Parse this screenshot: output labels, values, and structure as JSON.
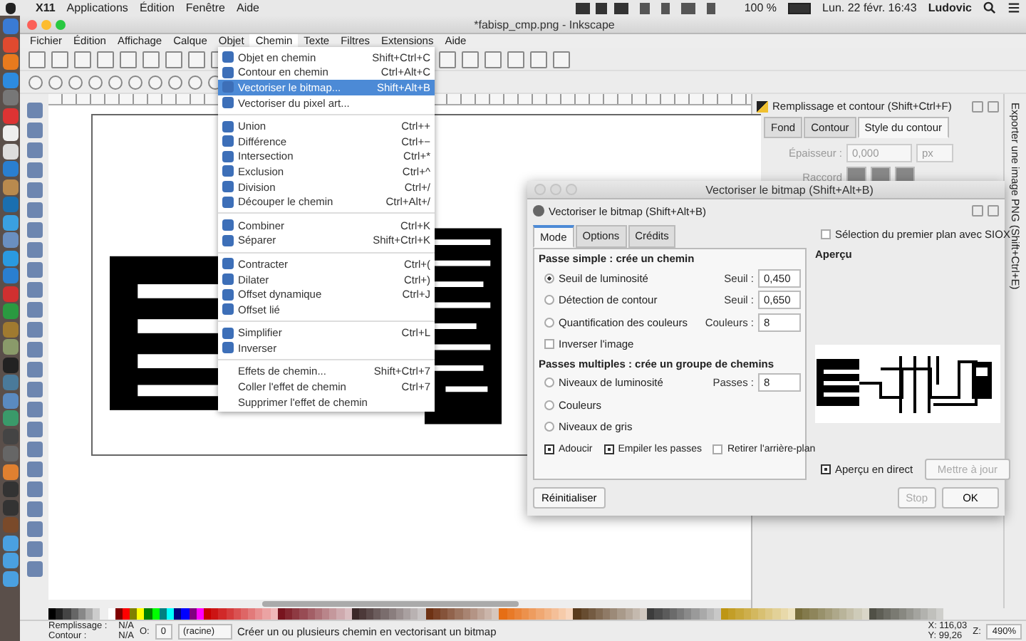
{
  "mac_menubar": {
    "app": "X11",
    "items": [
      "Applications",
      "Édition",
      "Fenêtre",
      "Aide"
    ],
    "battery": "100 %",
    "clock": "Lun. 22 févr. 16:43",
    "user": "Ludovic"
  },
  "window": {
    "title": "*fabisp_cmp.png - Inkscape"
  },
  "menubar": [
    {
      "label": "Fichier",
      "selected": false
    },
    {
      "label": "Édition",
      "selected": false
    },
    {
      "label": "Affichage",
      "selected": false
    },
    {
      "label": "Calque",
      "selected": false
    },
    {
      "label": "Objet",
      "selected": false
    },
    {
      "label": "Chemin",
      "selected": true
    },
    {
      "label": "Texte",
      "selected": false
    },
    {
      "label": "Filtres",
      "selected": false
    },
    {
      "label": "Extensions",
      "selected": false
    },
    {
      "label": "Aide",
      "selected": false
    }
  ],
  "chemin_menu": {
    "sections": [
      {
        "items": [
          {
            "label": "Objet en chemin",
            "shortcut": "Shift+Ctrl+C",
            "kind": "icon",
            "highlighted": false
          },
          {
            "label": "Contour en chemin",
            "shortcut": "Ctrl+Alt+C",
            "kind": "icon",
            "highlighted": false
          },
          {
            "label": "Vectoriser le bitmap...",
            "shortcut": "Shift+Alt+B",
            "kind": "icon",
            "highlighted": true
          },
          {
            "label": "Vectoriser du pixel art...",
            "kind": "icon",
            "highlighted": false
          }
        ]
      },
      {
        "items": [
          {
            "label": "Union",
            "shortcut": "Ctrl++",
            "kind": "icon",
            "highlighted": false
          },
          {
            "label": "Différence",
            "shortcut": "Ctrl+−",
            "kind": "icon",
            "highlighted": false
          },
          {
            "label": "Intersection",
            "shortcut": "Ctrl+*",
            "kind": "icon",
            "highlighted": false
          },
          {
            "label": "Exclusion",
            "shortcut": "Ctrl+^",
            "kind": "icon",
            "highlighted": false
          },
          {
            "label": "Division",
            "shortcut": "Ctrl+/",
            "kind": "icon",
            "highlighted": false
          },
          {
            "label": "Découper le chemin",
            "shortcut": "Ctrl+Alt+/",
            "kind": "icon",
            "highlighted": false
          }
        ]
      },
      {
        "items": [
          {
            "label": "Combiner",
            "shortcut": "Ctrl+K",
            "kind": "icon",
            "highlighted": false
          },
          {
            "label": "Séparer",
            "shortcut": "Shift+Ctrl+K",
            "kind": "icon",
            "highlighted": false
          }
        ]
      },
      {
        "items": [
          {
            "label": "Contracter",
            "shortcut": "Ctrl+(",
            "kind": "icon",
            "highlighted": false
          },
          {
            "label": "Dilater",
            "shortcut": "Ctrl+)",
            "kind": "icon",
            "highlighted": false
          },
          {
            "label": "Offset dynamique",
            "shortcut": "Ctrl+J",
            "kind": "icon",
            "highlighted": false
          },
          {
            "label": "Offset lié",
            "kind": "icon",
            "highlighted": false
          }
        ]
      },
      {
        "items": [
          {
            "label": "Simplifier",
            "shortcut": "Ctrl+L",
            "kind": "icon",
            "highlighted": false
          },
          {
            "label": "Inverser",
            "kind": "icon",
            "highlighted": false
          }
        ]
      },
      {
        "items": [
          {
            "label": "Effets de chemin...",
            "shortcut": "Shift+Ctrl+7",
            "kind": "text",
            "highlighted": false
          },
          {
            "label": "Coller l'effet de chemin",
            "shortcut": "Ctrl+7",
            "kind": "text",
            "highlighted": false
          },
          {
            "label": "Supprimer l'effet de chemin",
            "kind": "text",
            "highlighted": false
          }
        ]
      }
    ]
  },
  "fill_panel": {
    "title": "Remplissage et contour (Shift+Ctrl+F)",
    "tabs": [
      {
        "label": "Fond",
        "selected": false
      },
      {
        "label": "Contour",
        "selected": false
      },
      {
        "label": "Style du contour",
        "selected": true
      }
    ],
    "width_label": "Épaisseur :",
    "width_value": "0,000",
    "unit": "px",
    "join_label": "Raccord"
  },
  "side_tab": "Exporter une image PNG (Shift+Ctrl+E)",
  "trace_dialog": {
    "window_title": "Vectoriser le bitmap (Shift+Alt+B)",
    "title": "Vectoriser le bitmap (Shift+Alt+B)",
    "tabs": [
      {
        "label": "Mode",
        "selected": true
      },
      {
        "label": "Options",
        "selected": false
      },
      {
        "label": "Crédits",
        "selected": false
      }
    ],
    "single_heading": "Passe simple : crée un chemin",
    "single_options": [
      {
        "label": "Seuil de luminosité",
        "selected": true,
        "field_label": "Seuil :",
        "value": "0,450"
      },
      {
        "label": "Détection de contour",
        "selected": false,
        "field_label": "Seuil :",
        "value": "0,650"
      },
      {
        "label": "Quantification des couleurs",
        "selected": false,
        "field_label": "Couleurs :",
        "value": "8"
      }
    ],
    "invert": {
      "label": "Inverser l'image",
      "checked": false
    },
    "multi_heading": "Passes multiples : crée un groupe de chemins",
    "multi_options": [
      {
        "label": "Niveaux de luminosité",
        "selected": false,
        "field_label": "Passes :",
        "value": "8"
      },
      {
        "label": "Couleurs",
        "selected": false
      },
      {
        "label": "Niveaux de gris",
        "selected": false
      }
    ],
    "multi_checks": [
      {
        "label": "Adoucir",
        "checked": true
      },
      {
        "label": "Empiler les passes",
        "checked": true
      },
      {
        "label": "Retirer l'arrière-plan",
        "checked": false
      }
    ],
    "siox": {
      "label": "Sélection du premier plan avec SIOX",
      "checked": false
    },
    "preview_label": "Aperçu",
    "live": {
      "label": "Aperçu en direct",
      "checked": true
    },
    "update_button": "Mettre à jour",
    "reset_button": "Réinitialiser",
    "stop_button": "Stop",
    "ok_button": "OK"
  },
  "status_bar": {
    "fill_label": "Remplissage :",
    "fill_value": "N/A",
    "stroke_label": "Contour :",
    "stroke_value": "N/A",
    "opacity_label": "O:",
    "opacity_value": "0",
    "layer": "(racine)",
    "message": "Créer un ou plusieurs chemin en vectorisant un bitmap",
    "x_label": "X:",
    "x_value": "116,03",
    "y_label": "Y:",
    "y_value": "99,26",
    "zoom_label": "Z:",
    "zoom_value": "490%"
  }
}
